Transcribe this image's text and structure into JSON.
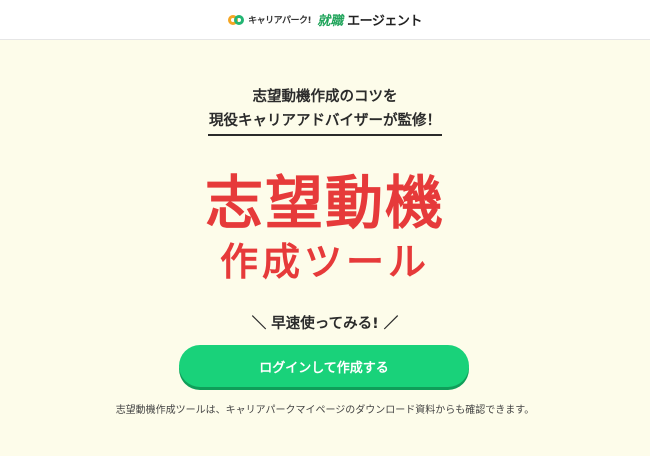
{
  "header": {
    "logo_part1": "キャリアパーク!",
    "logo_part2": "就職",
    "logo_part3": "エージェント"
  },
  "hero": {
    "bubble_line1": "志望動機作成のコツを",
    "bubble_line2": "現役キャリアアドバイザーが監修！",
    "title_line1": "志望動機",
    "title_line2": "作成ツール",
    "try_now": "＼ 早速使ってみる! ／",
    "cta_label": "ログインして作成する",
    "note": "志望動機作成ツールは、キャリアパークマイページのダウンロード資料からも確認できます。"
  },
  "colors": {
    "background": "#fdfcea",
    "accent_red": "#e63a3a",
    "cta_green": "#19d27a",
    "brand_green": "#22a55c"
  }
}
